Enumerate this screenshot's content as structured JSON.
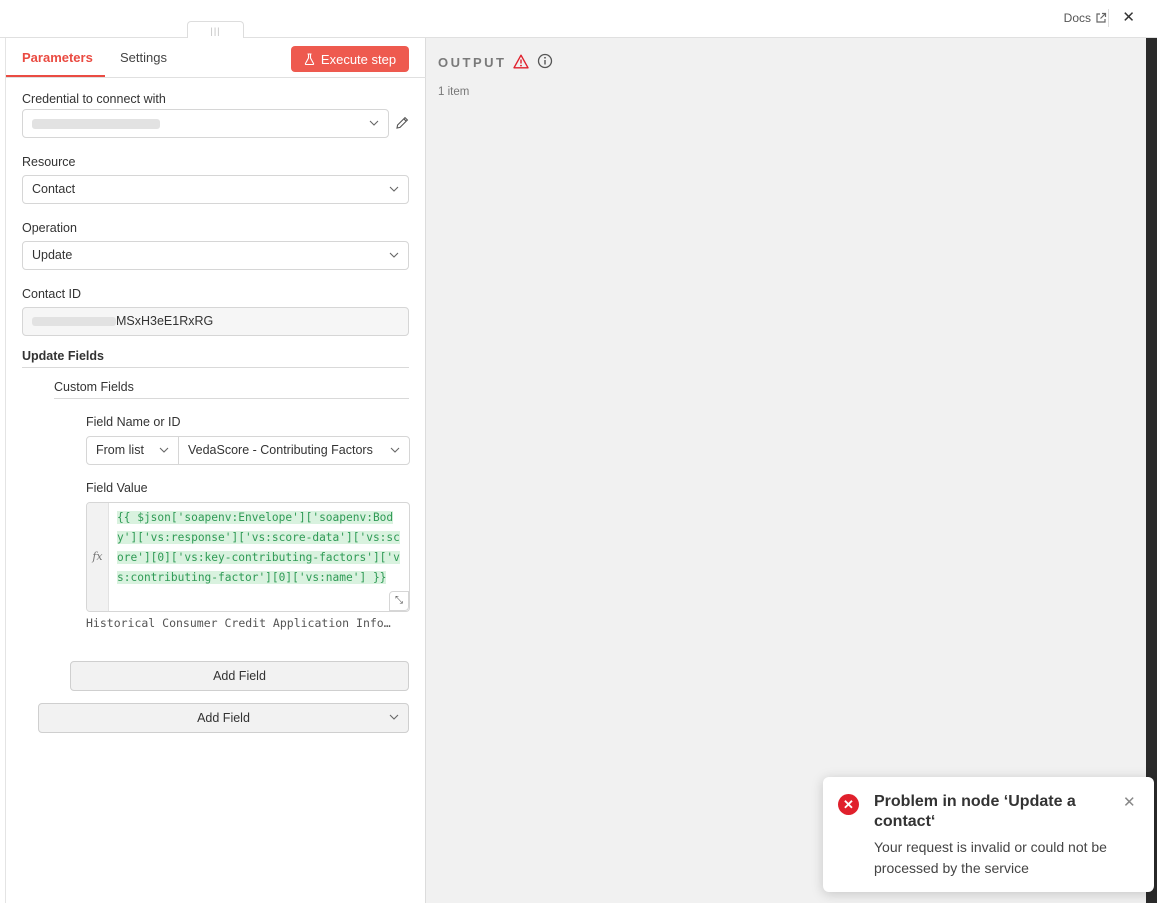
{
  "header": {
    "docs_label": "Docs",
    "close_glyph": "✕",
    "drag_glyph": "|||"
  },
  "tabs": {
    "parameters": "Parameters",
    "settings": "Settings",
    "active": "Parameters"
  },
  "execute_label": "Execute step",
  "form": {
    "credential": {
      "label": "Credential to connect with",
      "value": ""
    },
    "resource": {
      "label": "Resource",
      "value": "Contact"
    },
    "operation": {
      "label": "Operation",
      "value": "Update"
    },
    "contact_id": {
      "label": "Contact ID",
      "value_visible": "MSxH3eE1RxRG"
    },
    "update_fields": {
      "title": "Update Fields"
    },
    "custom_fields": {
      "title": "Custom Fields",
      "field_name_label": "Field Name or ID",
      "mode_value": "From list",
      "field_value": "VedaScore - Contributing Factors",
      "field_value_label": "Field Value",
      "fx_glyph": "fx",
      "expression": "{{ $json['soapenv:Envelope']['soapenv:Body']['vs:response']['vs:score-data']['vs:score'][0]['vs:key-contributing-factors']['vs:contributing-factor'][0]['vs:name'] }}",
      "expression_preview": "Historical Consumer Credit Application Info…"
    },
    "add_field_inner": "Add Field",
    "add_field_outer": "Add Field"
  },
  "output": {
    "title": "OUTPUT",
    "item_count": "1 item"
  },
  "toast": {
    "title": "Problem in node ‘Update a contact‘",
    "message": "Your request is invalid or could not be processed by the service",
    "icon_glyph": "✕",
    "close_glyph": "✕"
  },
  "colors": {
    "accent": "#ea4b42",
    "execute_bg": "#ee5a4f",
    "error": "#e0202c",
    "expression_text": "#2f9a55",
    "expression_bg": "#d9f2df"
  },
  "icons": [
    "external-link-icon",
    "close-icon",
    "flask-icon",
    "chevron-down-icon",
    "pencil-icon",
    "warning-icon",
    "info-icon",
    "error-icon",
    "expand-icon",
    "drag-handle-icon"
  ]
}
